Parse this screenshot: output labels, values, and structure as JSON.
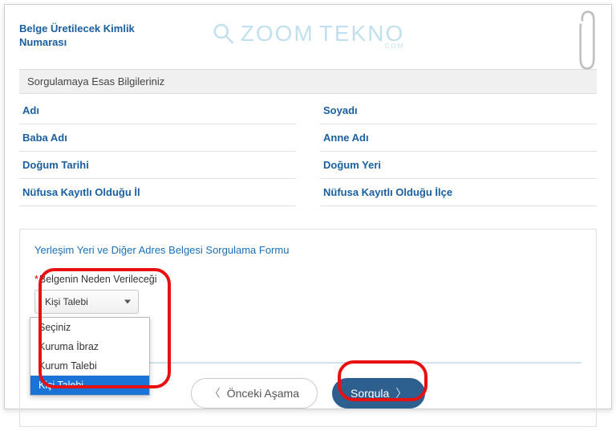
{
  "watermark": {
    "brand1": "ZOOM",
    "brand2": "TEKNO",
    "sub": ".COM"
  },
  "header": {
    "title_line1": "Belge Üretilecek Kimlik",
    "title_line2": "Numarası"
  },
  "section": {
    "title": "Sorgulamaya Esas Bilgileriniz"
  },
  "info": {
    "adi": "Adı",
    "soyadi": "Soyadı",
    "baba_adi": "Baba Adı",
    "anne_adi": "Anne Adı",
    "dogum_tarihi": "Doğum Tarihi",
    "dogum_yeri": "Doğum Yeri",
    "il": "Nüfusa Kayıtlı Olduğu İl",
    "ilce": "Nüfusa Kayıtlı Olduğu İlçe"
  },
  "form": {
    "title": "Yerleşim Yeri ve Diğer Adres Belgesi Sorgulama Formu",
    "reason_label": "Belgenin Neden Verileceği",
    "reason_selected": "Kişi Talebi",
    "options": {
      "o0": "Seçiniz",
      "o1": "Kuruma İbraz",
      "o2": "Kurum Talebi",
      "o3": "Kişi Talebi"
    },
    "prev_label": "Önceki Aşama",
    "submit_label": "Sorgula"
  }
}
